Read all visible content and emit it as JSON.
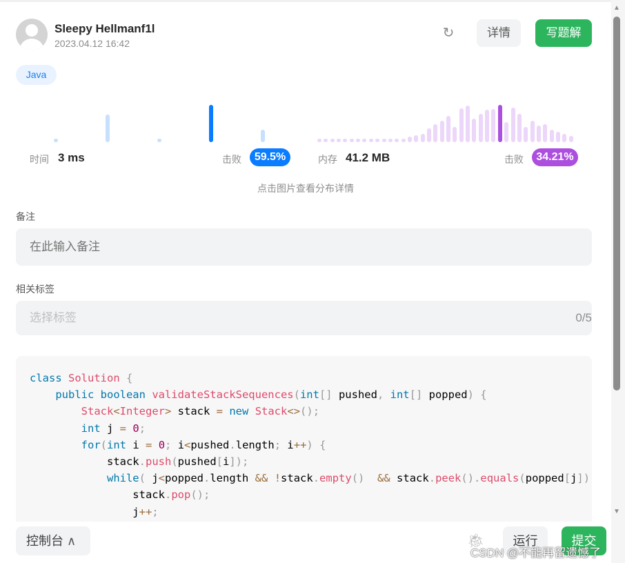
{
  "header": {
    "username": "Sleepy Hellmanf1l",
    "date": "2023.04.12 16:42",
    "detail_label": "详情",
    "write_label": "写题解",
    "refresh_icon": "refresh-icon"
  },
  "language_tag": "Java",
  "colors": {
    "time_accent": "#0a7cff",
    "time_bar": "#c6e0fe",
    "mem_accent": "#ac4fdf",
    "mem_bar": "#ecd6fa",
    "green": "#2db55d"
  },
  "time": {
    "label": "时间",
    "value": "3 ms",
    "beat_label": "击败",
    "beat": "59.5%"
  },
  "memory": {
    "label": "内存",
    "value": "41.2 MB",
    "beat_label": "击败",
    "beat": "34.21%"
  },
  "chart_data": [
    {
      "type": "bar",
      "title": "",
      "values": [
        1,
        30,
        1,
        40,
        13
      ],
      "highlight_index": 3
    },
    {
      "type": "bar",
      "title": "",
      "values": [
        1,
        1,
        1,
        1,
        1,
        1,
        1,
        1,
        1,
        1,
        1,
        1,
        1,
        2,
        8,
        10,
        12,
        20,
        26,
        30,
        37,
        22,
        48,
        52,
        33,
        40,
        46,
        47,
        53,
        28,
        49,
        40,
        22,
        30,
        24,
        26,
        18,
        15,
        12,
        9
      ],
      "highlight_index": 28
    }
  ],
  "hint": "点击图片查看分布详情",
  "notes": {
    "label": "备注",
    "placeholder": "在此输入备注"
  },
  "tags": {
    "label": "相关标签",
    "placeholder": "选择标签",
    "count": "0/5"
  },
  "code": [
    [
      [
        "class ",
        "k"
      ],
      [
        "Solution ",
        "f"
      ],
      [
        "{",
        "p"
      ]
    ],
    [
      [
        "    public boolean ",
        "k"
      ],
      [
        "validateStackSequences",
        "f"
      ],
      [
        "(",
        "p"
      ],
      [
        "int",
        "k"
      ],
      [
        "[]",
        "p"
      ],
      [
        " pushed",
        ""
      ],
      [
        ", ",
        "p"
      ],
      [
        "int",
        "k"
      ],
      [
        "[]",
        "p"
      ],
      [
        " popped",
        ""
      ],
      [
        ") {",
        "p"
      ]
    ],
    [
      [
        "        Stack",
        "f"
      ],
      [
        "<",
        "o"
      ],
      [
        "Integer",
        "f"
      ],
      [
        ">",
        "o"
      ],
      [
        " stack ",
        ""
      ],
      [
        "=",
        "o"
      ],
      [
        " new ",
        "k"
      ],
      [
        "Stack",
        "f"
      ],
      [
        "<>",
        "o"
      ],
      [
        "();",
        "p"
      ]
    ],
    [
      [
        "        int",
        "k"
      ],
      [
        " j ",
        ""
      ],
      [
        "=",
        "o"
      ],
      [
        " ",
        ""
      ],
      [
        "0",
        "n"
      ],
      [
        ";",
        "p"
      ]
    ],
    [
      [
        "        for",
        "k"
      ],
      [
        "(",
        "p"
      ],
      [
        "int",
        "k"
      ],
      [
        " i ",
        ""
      ],
      [
        "=",
        "o"
      ],
      [
        " ",
        ""
      ],
      [
        "0",
        "n"
      ],
      [
        ";",
        "p"
      ],
      [
        " i",
        ""
      ],
      [
        "<",
        "o"
      ],
      [
        "pushed",
        ""
      ],
      [
        ".",
        "p"
      ],
      [
        "length",
        ""
      ],
      [
        ";",
        "p"
      ],
      [
        " i",
        ""
      ],
      [
        "++",
        "o"
      ],
      [
        ") {",
        "p"
      ]
    ],
    [
      [
        "            stack",
        ""
      ],
      [
        ".",
        "p"
      ],
      [
        "push",
        "f"
      ],
      [
        "(",
        "p"
      ],
      [
        "pushed",
        ""
      ],
      [
        "[",
        "p"
      ],
      [
        "i",
        ""
      ],
      [
        "]);",
        "p"
      ]
    ],
    [
      [
        "            while",
        "k"
      ],
      [
        "( ",
        "p"
      ],
      [
        "j",
        ""
      ],
      [
        "<",
        "o"
      ],
      [
        "popped",
        ""
      ],
      [
        ".",
        "p"
      ],
      [
        "length ",
        ""
      ],
      [
        "&&",
        "o"
      ],
      [
        " ",
        ""
      ],
      [
        "!",
        "o"
      ],
      [
        "stack",
        ""
      ],
      [
        ".",
        "p"
      ],
      [
        "empty",
        "f"
      ],
      [
        "()  ",
        "p"
      ],
      [
        "&&",
        "o"
      ],
      [
        " stack",
        ""
      ],
      [
        ".",
        "p"
      ],
      [
        "peek",
        "f"
      ],
      [
        "().",
        "p"
      ],
      [
        "equals",
        "f"
      ],
      [
        "(",
        "p"
      ],
      [
        "popped",
        ""
      ],
      [
        "[",
        "p"
      ],
      [
        "j",
        ""
      ],
      [
        "]))",
        "p"
      ]
    ],
    [
      [
        "                stack",
        ""
      ],
      [
        ".",
        "p"
      ],
      [
        "pop",
        "f"
      ],
      [
        "();",
        "p"
      ]
    ],
    [
      [
        "                j",
        ""
      ],
      [
        "++",
        "o"
      ],
      [
        ";",
        "p"
      ]
    ]
  ],
  "footer": {
    "console_label": "控制台",
    "run_label": "运行",
    "submit_label": "提交",
    "watermark": "CSDN @不能再留遗憾了"
  }
}
